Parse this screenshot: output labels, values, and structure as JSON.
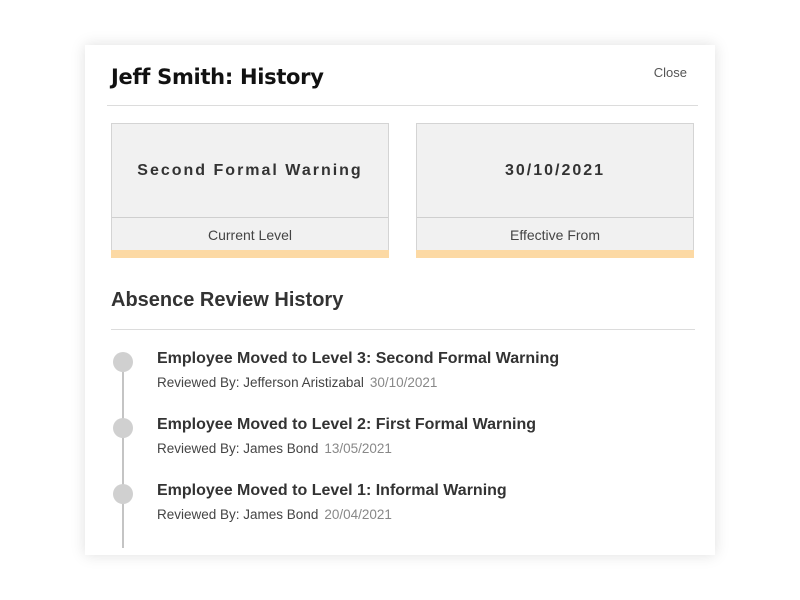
{
  "modal": {
    "title": "Jeff Smith: History",
    "close_label": "Close"
  },
  "cards": [
    {
      "value": "Second Formal Warning",
      "label": "Current Level"
    },
    {
      "value": "30/10/2021",
      "label": "Effective From"
    }
  ],
  "history": {
    "title": "Absence Review History",
    "items": [
      {
        "title": "Employee Moved to Level 3: Second Formal Warning",
        "reviewed_by": "Reviewed By: Jefferson Aristizabal",
        "date": "30/10/2021"
      },
      {
        "title": "Employee Moved to Level 2: First Formal Warning",
        "reviewed_by": "Reviewed By: James Bond",
        "date": "13/05/2021"
      },
      {
        "title": "Employee Moved to Level 1: Informal Warning",
        "reviewed_by": "Reviewed By: James Bond",
        "date": "20/04/2021"
      }
    ]
  },
  "colors": {
    "accent_bar": "#fcd9a4",
    "timeline_dot": "#d0d0d0"
  }
}
